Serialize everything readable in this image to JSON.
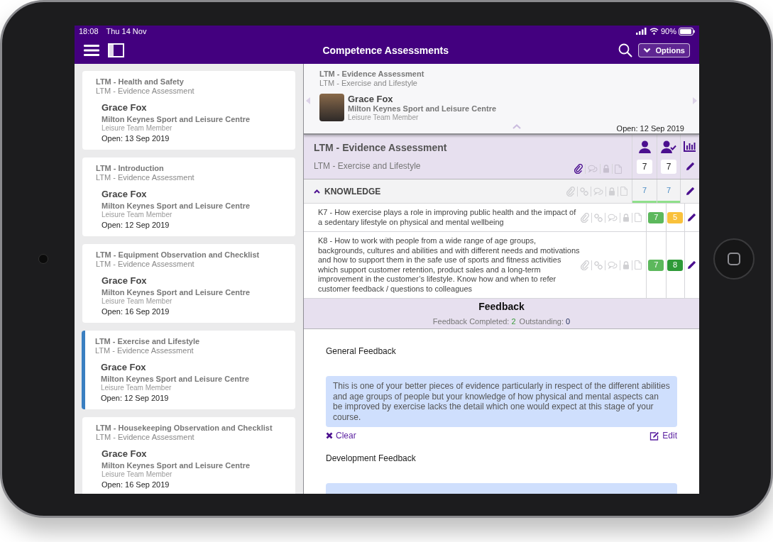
{
  "status_bar": {
    "time": "18:08",
    "date": "Thu 14 Nov",
    "battery": "90%"
  },
  "nav": {
    "title": "Competence Assessments",
    "options_label": "Options"
  },
  "list": [
    {
      "unit": "LTM - Health and Safety",
      "type": "LTM - Evidence Assessment",
      "name": "Grace Fox",
      "centre": "Milton Keynes Sport and Leisure Centre",
      "role": "Leisure Team Member",
      "opened": "Open: 13 Sep 2019",
      "selected": false
    },
    {
      "unit": "LTM - Introduction",
      "type": "LTM - Evidence Assessment",
      "name": "Grace Fox",
      "centre": "Milton Keynes Sport and Leisure Centre",
      "role": "Leisure Team Member",
      "opened": "Open: 12 Sep 2019",
      "selected": false
    },
    {
      "unit": "LTM - Equipment Observation and Checklist",
      "type": "LTM - Evidence Assessment",
      "name": "Grace Fox",
      "centre": "Milton Keynes Sport and Leisure Centre",
      "role": "Leisure Team Member",
      "opened": "Open: 16 Sep 2019",
      "selected": false
    },
    {
      "unit": "LTM - Exercise and Lifestyle",
      "type": "LTM - Evidence Assessment",
      "name": "Grace Fox",
      "centre": "Milton Keynes Sport and Leisure Centre",
      "role": "Leisure Team Member",
      "opened": "Open: 12 Sep 2019",
      "selected": true
    },
    {
      "unit": "LTM - Housekeeping Observation and Checklist",
      "type": "LTM - Evidence Assessment",
      "name": "Grace Fox",
      "centre": "Milton Keynes Sport and Leisure Centre",
      "role": "Leisure Team Member",
      "opened": "Open: 16 Sep 2019",
      "selected": false
    }
  ],
  "detail_header": {
    "type": "LTM - Evidence Assessment",
    "unit": "LTM - Exercise and Lifestyle",
    "name": "Grace Fox",
    "centre": "Milton Keynes Sport and Leisure Centre",
    "role": "Leisure Team Member",
    "opened": "Open: 12 Sep 2019"
  },
  "assessment": {
    "title": "LTM - Evidence Assessment",
    "subtitle": "LTM - Exercise and Lifestyle",
    "has_attachment": true,
    "learner_count": "7",
    "assessor_count": "7"
  },
  "section": {
    "title": "KNOWLEDGE",
    "expanded": true,
    "learner_count": "7",
    "assessor_count": "7"
  },
  "criteria": [
    {
      "text": "K7 - How exercise plays a role in improving public health and the impact of a sedentary lifestyle on physical and mental wellbeing",
      "learner": {
        "value": "7",
        "color": "#5cb85c"
      },
      "assessor": {
        "value": "5",
        "color": "#f9c13b"
      }
    },
    {
      "text": "K8 - How to work with people from a wide range of age groups, backgrounds, cultures and abilities and with different needs and motivations and how to support them in the safe use of sports and fitness activities which support customer retention, product sales and a long-term improvement in the customer’s lifestyle. Know how and when to refer customer feedback / questions to colleagues",
      "learner": {
        "value": "7",
        "color": "#5cb85c"
      },
      "assessor": {
        "value": "8",
        "color": "#2e9a38"
      }
    }
  ],
  "feedback": {
    "title": "Feedback",
    "completed_label": "Feedback Completed:",
    "completed": "2",
    "outstanding_label": "Outstanding:",
    "outstanding": "0",
    "items": [
      {
        "label": "General Feedback",
        "text": "This is one of your better pieces of evidence particularly in respect of the different abilities and age groups of people but your knowledge of how physical and mental aspects can be improved by exercise lacks the detail which one would expect at this stage of your course.",
        "clear": "Clear",
        "edit": "Edit"
      },
      {
        "label": "Development Feedback"
      }
    ]
  }
}
